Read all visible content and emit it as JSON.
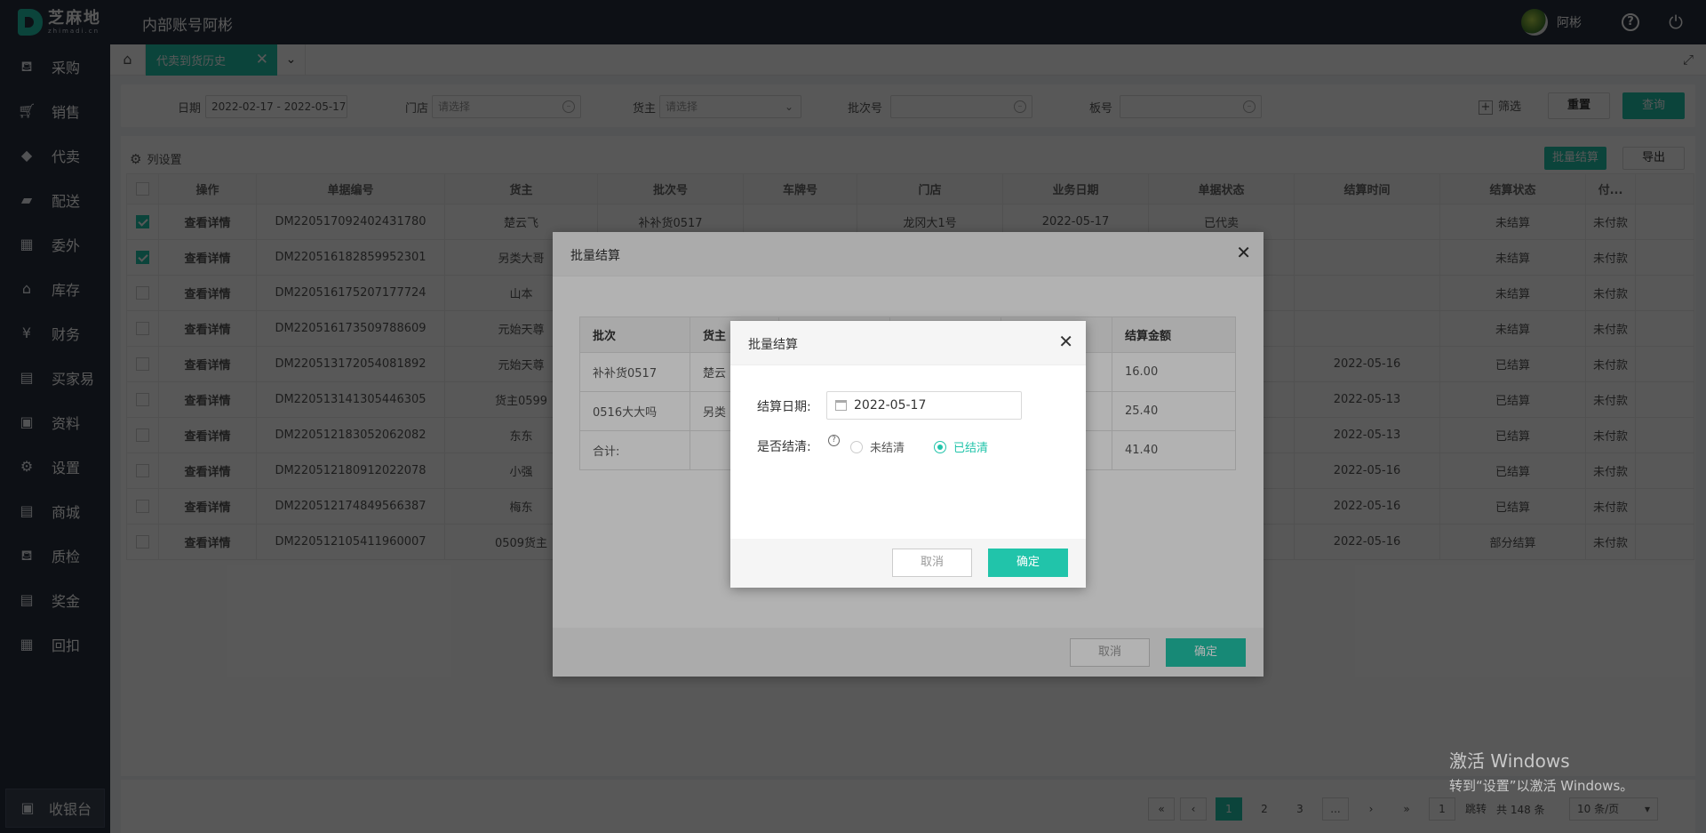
{
  "app": {
    "logo_text": "芝麻地",
    "logo_sub": "zhimadi.cn",
    "title": "内部账号阿彬",
    "user_name": "阿彬"
  },
  "sidebar": {
    "items": [
      {
        "label": "采购",
        "icon": "basket-icon"
      },
      {
        "label": "销售",
        "icon": "cart-icon"
      },
      {
        "label": "代卖",
        "icon": "tag-icon"
      },
      {
        "label": "配送",
        "icon": "truck-icon"
      },
      {
        "label": "委外",
        "icon": "building-icon"
      },
      {
        "label": "库存",
        "icon": "warehouse-icon"
      },
      {
        "label": "财务",
        "icon": "yen-icon"
      },
      {
        "label": "买家易",
        "icon": "store-icon"
      },
      {
        "label": "资料",
        "icon": "archive-icon"
      },
      {
        "label": "设置",
        "icon": "gear-icon"
      },
      {
        "label": "商城",
        "icon": "shop-icon"
      },
      {
        "label": "质检",
        "icon": "inspect-icon"
      },
      {
        "label": "奖金",
        "icon": "bonus-icon"
      },
      {
        "label": "回扣",
        "icon": "rebate-icon"
      }
    ],
    "cashier": "收银台"
  },
  "tabs": {
    "active": "代卖到货历史"
  },
  "filters": {
    "date_label": "日期",
    "date_value": "2022-02-17 - 2022-05-17",
    "store_label": "门店",
    "store_placeholder": "请选择",
    "owner_label": "货主",
    "owner_placeholder": "请选择",
    "batch_label": "批次号",
    "plate_label": "板号",
    "filter_btn": "筛选",
    "reset_btn": "重置",
    "query_btn": "查询"
  },
  "table": {
    "col_settings": "列设置",
    "batch_settle_btn": "批量结算",
    "export_btn": "导出",
    "headers": [
      "操作",
      "单据编号",
      "货主",
      "批次号",
      "车牌号",
      "门店",
      "业务日期",
      "单据状态",
      "结算时间",
      "结算状态",
      "付..."
    ],
    "rows": [
      {
        "checked": true,
        "op": "查看详情",
        "no": "DM220517092402431780",
        "owner": "楚云飞",
        "batch": "补补货0517",
        "plate": "",
        "store": "龙冈大1号",
        "date": "2022-05-17",
        "status": "已代卖",
        "settle_time": "",
        "settle_status": "未结算",
        "pay": "未付款"
      },
      {
        "checked": true,
        "op": "查看详情",
        "no": "DM220516182859952301",
        "owner": "另类大哥",
        "batch": "",
        "plate": "",
        "store": "",
        "date": "",
        "status": "",
        "settle_time": "",
        "settle_status": "未结算",
        "pay": "未付款"
      },
      {
        "checked": false,
        "op": "查看详情",
        "no": "DM220516175207177724",
        "owner": "山本",
        "batch": "",
        "plate": "",
        "store": "",
        "date": "",
        "status": "",
        "settle_time": "",
        "settle_status": "未结算",
        "pay": "未付款"
      },
      {
        "checked": false,
        "op": "查看详情",
        "no": "DM220516173509788609",
        "owner": "元始天尊",
        "batch": "",
        "plate": "",
        "store": "",
        "date": "",
        "status": "",
        "settle_time": "",
        "settle_status": "未结算",
        "pay": "未付款"
      },
      {
        "checked": false,
        "op": "查看详情",
        "no": "DM220513172054081892",
        "owner": "元始天尊",
        "batch": "",
        "plate": "",
        "store": "",
        "date": "",
        "status": "",
        "settle_time": "2022-05-16",
        "settle_status": "已结算",
        "pay": "未付款"
      },
      {
        "checked": false,
        "op": "查看详情",
        "no": "DM220513141305446305",
        "owner": "货主0599",
        "batch": "",
        "plate": "",
        "store": "",
        "date": "",
        "status": "",
        "settle_time": "2022-05-13",
        "settle_status": "已结算",
        "pay": "未付款"
      },
      {
        "checked": false,
        "op": "查看详情",
        "no": "DM220512183052062082",
        "owner": "东东",
        "batch": "",
        "plate": "",
        "store": "",
        "date": "",
        "status": "",
        "settle_time": "2022-05-13",
        "settle_status": "已结算",
        "pay": "未付款"
      },
      {
        "checked": false,
        "op": "查看详情",
        "no": "DM220512180912022078",
        "owner": "小强",
        "batch": "",
        "plate": "",
        "store": "",
        "date": "",
        "status": "",
        "settle_time": "2022-05-16",
        "settle_status": "已结算",
        "pay": "未付款"
      },
      {
        "checked": false,
        "op": "查看详情",
        "no": "DM220512174849566387",
        "owner": "梅东",
        "batch": "",
        "plate": "",
        "store": "",
        "date": "",
        "status": "",
        "settle_time": "2022-05-16",
        "settle_status": "已结算",
        "pay": "未付款"
      },
      {
        "checked": false,
        "op": "查看详情",
        "no": "DM220512105411960007",
        "owner": "0509货主",
        "batch": "",
        "plate": "",
        "store": "",
        "date": "",
        "status": "",
        "settle_time": "2022-05-16",
        "settle_status": "部分结算",
        "pay": "未付款"
      }
    ]
  },
  "pager": {
    "pages": [
      "1",
      "2",
      "3",
      "..."
    ],
    "current": "1",
    "jump_value": "1",
    "jump_label": "跳转",
    "total": "共 148 条",
    "page_size": "10 条/页"
  },
  "dialog_outer": {
    "title": "批量结算",
    "headers": [
      "批次",
      "货主",
      "",
      "",
      "",
      "结算金额"
    ],
    "rows": [
      {
        "batch": "补补货0517",
        "owner": "楚云",
        "amount": "16.00"
      },
      {
        "batch": "0516大大吗",
        "owner": "另类",
        "amount": "25.40"
      },
      {
        "batch": "合计:",
        "owner": "",
        "amount": "41.40"
      }
    ],
    "cancel": "取消",
    "ok": "确定"
  },
  "dialog_inner": {
    "title": "批量结算",
    "date_label": "结算日期:",
    "date_value": "2022-05-17",
    "clear_label": "是否结清:",
    "opt_unsettled": "未结清",
    "opt_settled": "已结清",
    "cancel": "取消",
    "ok": "确定"
  },
  "watermark": {
    "line1": "激活 Windows",
    "line2": "转到“设置”以激活 Windows。"
  },
  "colors": {
    "accent": "#21c4aa",
    "nav_bg": "#28303f"
  }
}
